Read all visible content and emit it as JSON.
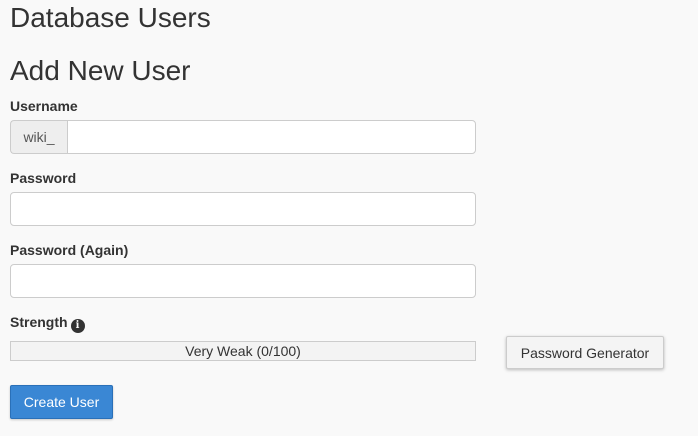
{
  "page": {
    "title": "Database Users",
    "section_title": "Add New User"
  },
  "form": {
    "username": {
      "label": "Username",
      "prefix": "wiki_",
      "value": ""
    },
    "password": {
      "label": "Password",
      "value": ""
    },
    "password_again": {
      "label": "Password (Again)",
      "value": ""
    },
    "strength": {
      "label": "Strength",
      "icon": "info-circle-icon",
      "text": "Very Weak (0/100)",
      "score": 0,
      "max": 100
    },
    "generator_button": "Password Generator",
    "submit_button": "Create User"
  },
  "colors": {
    "primary_button": "#3a87d4",
    "strength_weak": "#d9534f"
  }
}
